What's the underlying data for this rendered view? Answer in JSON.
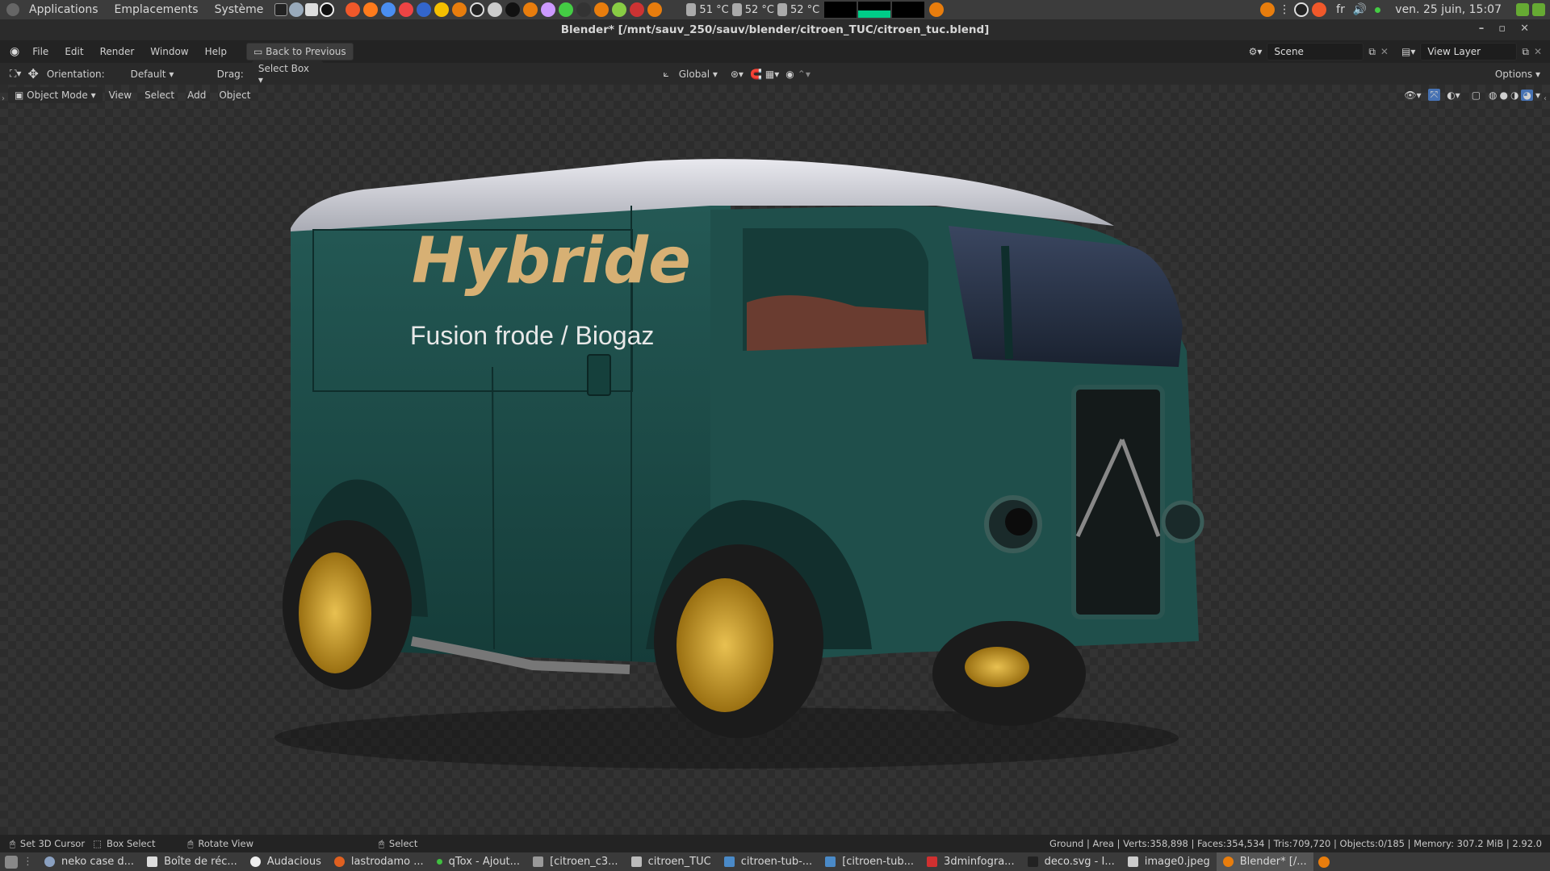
{
  "gnome_panel": {
    "menus": [
      "Applications",
      "Emplacements",
      "Système"
    ],
    "temps": [
      "51 °C",
      "52 °C",
      "52 °C"
    ],
    "keyboard_layout": "fr",
    "clock": "ven. 25 juin, 15:07"
  },
  "window": {
    "title": "Blender* [/mnt/sauv_250/sauv/blender/citroen_TUC/citroen_tuc.blend]"
  },
  "topbar": {
    "menus": [
      "File",
      "Edit",
      "Render",
      "Window",
      "Help"
    ],
    "back_button": "Back to Previous",
    "scene": "Scene",
    "view_layer": "View Layer"
  },
  "tool_header": {
    "orientation_label": "Orientation:",
    "orientation_value": "Default",
    "drag_label": "Drag:",
    "drag_value": "Select Box",
    "transform_space": "Global",
    "options": "Options"
  },
  "viewport_header": {
    "mode": "Object Mode",
    "menus": [
      "View",
      "Select",
      "Add",
      "Object"
    ]
  },
  "scene_render": {
    "van_headline": "Hybride",
    "van_subline": "Fusion frode / Biogaz",
    "body_color": "#1d4a47",
    "wheel_color": "#c89a2a"
  },
  "status_bar": {
    "hint1": "Set 3D Cursor",
    "hint2": "Box Select",
    "hint3": "Rotate View",
    "hint4": "Select",
    "stats": "Ground | Area | Verts:358,898 | Faces:354,534 | Tris:709,720 | Objects:0/185 | Memory: 307.2 MiB | 2.92.0"
  },
  "taskbar": {
    "items": [
      {
        "label": "neko case d...",
        "color": "#8aa0c0"
      },
      {
        "label": "Boîte de réc...",
        "color": "#dddddd"
      },
      {
        "label": "Audacious",
        "color": "#eeeeee"
      },
      {
        "label": "lastrodamo ...",
        "color": "#e06020"
      },
      {
        "label": "qTox - Ajout...",
        "color": "#40c040"
      },
      {
        "label": "[citroen_c3...",
        "color": "#999999"
      },
      {
        "label": "citroen_TUC",
        "color": "#bbbbbb"
      },
      {
        "label": "citroen-tub-...",
        "color": "#4a8ac8"
      },
      {
        "label": "[citroen-tub...",
        "color": "#4a8ac8"
      },
      {
        "label": "3dminfogra...",
        "color": "#d03030"
      },
      {
        "label": "deco.svg - I...",
        "color": "#222222"
      },
      {
        "label": "image0.jpeg",
        "color": "#cccccc"
      },
      {
        "label": "Blender* [/...",
        "color": "#e87d0d"
      }
    ]
  }
}
